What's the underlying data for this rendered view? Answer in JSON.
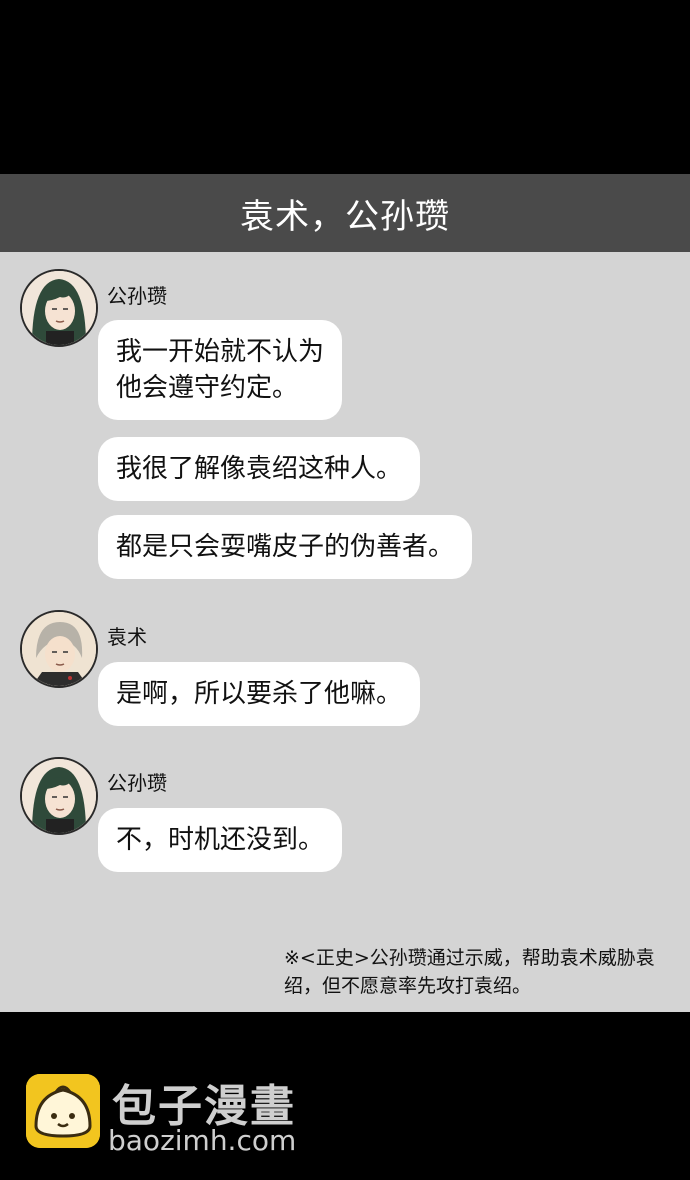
{
  "header": {
    "title": "袁术，公孙瓒"
  },
  "messages": [
    {
      "sender": "公孙瓒",
      "avatar_icon": "gongsunzan-avatar-icon",
      "bubbles": [
        "我一开始就不认为\n他会遵守约定。",
        "我很了解像袁绍这种人。",
        "都是只会耍嘴皮子的伪善者。"
      ]
    },
    {
      "sender": "袁术",
      "avatar_icon": "yuanshu-avatar-icon",
      "bubbles": [
        "是啊，所以要杀了他嘛。"
      ]
    },
    {
      "sender": "公孙瓒",
      "avatar_icon": "gongsunzan-avatar-icon",
      "bubbles": [
        "不，时机还没到。"
      ]
    }
  ],
  "footnote": "※<正史>公孙瓒通过示威，帮助袁术威胁袁绍，但不愿意率先攻打袁绍。",
  "watermark": {
    "name": "包子漫畫",
    "url": "baozimh.com",
    "icon": "bun-logo-icon"
  },
  "colors": {
    "title_bar": "#4a4a4a",
    "chat_background": "#d4d4d4",
    "bubble": "#ffffff",
    "logo_yellow": "#f2c51f"
  }
}
